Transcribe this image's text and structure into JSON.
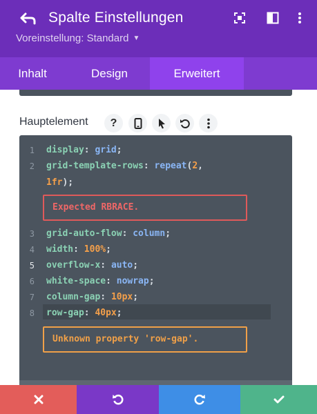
{
  "header": {
    "title": "Spalte Einstellungen",
    "preset_label": "Voreinstellung: Standard",
    "icons": [
      "back-arrow-icon",
      "fullscreen-icon",
      "sidebar-layout-icon",
      "more-vertical-icon"
    ],
    "colors": {
      "header_bg": "#6c2eb9",
      "tabs_bg": "#7e3bd0",
      "active_tab_bg": "#8f42ec"
    }
  },
  "tabs": [
    {
      "label": "Inhalt",
      "active": false
    },
    {
      "label": "Design",
      "active": false
    },
    {
      "label": "Erweitert",
      "active": true
    }
  ],
  "field": {
    "label": "Hauptelement",
    "icons": [
      "help-icon",
      "mobile-icon",
      "pointer-icon",
      "reset-icon",
      "more-vertical-icon"
    ]
  },
  "editor": {
    "line_numbers": [
      "1",
      "2",
      "3",
      "4",
      "5",
      "6",
      "7",
      "8"
    ],
    "active_line": 5,
    "lines": {
      "l1": {
        "prop": "display",
        "value": "grid"
      },
      "l2": {
        "prop": "grid-template-rows",
        "func": "repeat",
        "arg1": "2",
        "arg2": "1fr"
      },
      "l3": {
        "prop": "grid-auto-flow",
        "value": "column"
      },
      "l4": {
        "prop": "width",
        "value": "100%"
      },
      "l5": {
        "prop": "overflow-x",
        "value": "auto"
      },
      "l6": {
        "prop": "white-space",
        "value": "nowrap"
      },
      "l7": {
        "prop": "column-gap",
        "value": "10px"
      },
      "l8": {
        "prop": "row-gap",
        "value": "40px"
      }
    },
    "error_message": "Expected RBRACE.",
    "warning_message": "Unknown property 'row-gap'.",
    "colors": {
      "bg": "#4b545e",
      "property": "#8bd2b4",
      "keyword": "#8ab6f5",
      "number": "#f5a04a",
      "error": "#e05a5a",
      "warning": "#f0a048"
    }
  },
  "actions": {
    "icons": [
      "close-icon",
      "undo-icon",
      "redo-icon",
      "check-icon"
    ],
    "colors": {
      "cancel": "#e35d5a",
      "undo": "#7a38c7",
      "redo": "#3e8ee6",
      "save": "#4fb48b"
    }
  }
}
